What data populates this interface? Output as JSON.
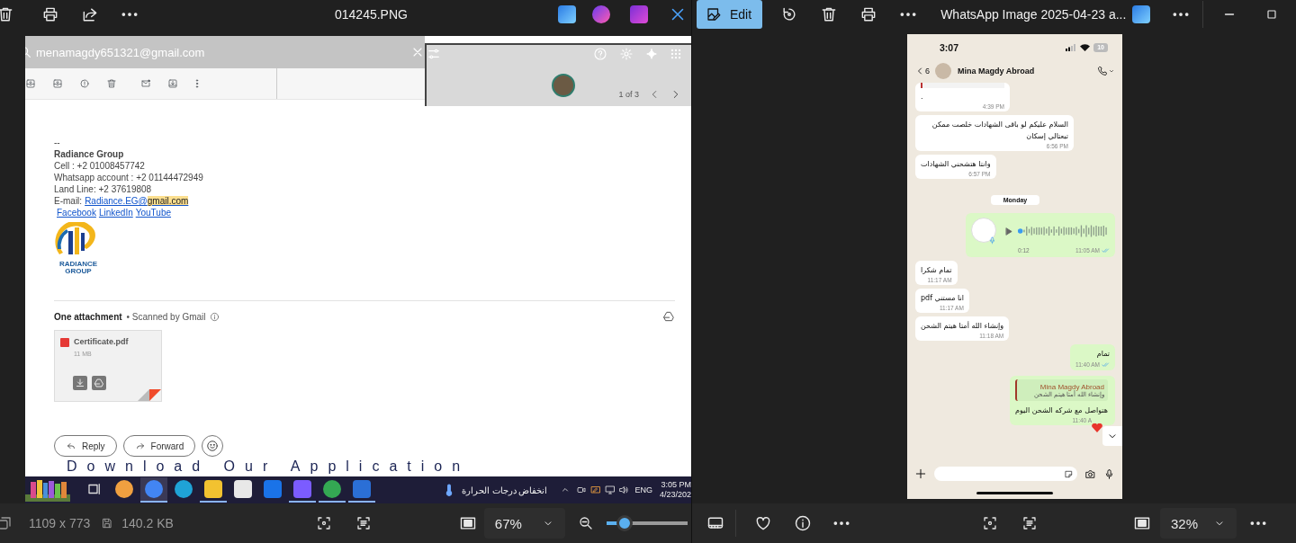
{
  "left_window": {
    "title": "014245.PNG",
    "info": {
      "dimensions": "1109 x 773",
      "file_size": "140.2 KB"
    },
    "zoom": {
      "value": "67%",
      "level": 0.22
    }
  },
  "email": {
    "search_value": "menamagdy651321@gmail.com",
    "pager": "1 of 3",
    "signature": {
      "separator": "--",
      "company": "Radiance Group",
      "lines": [
        "Cell : +2 01008457742",
        "Whatsapp account : +2 01144472949",
        "Land Line: +2 37619808"
      ],
      "email_label": "E-mail:",
      "email_link": "Radiance.EG@",
      "email_highlight": "gmail.com",
      "social_links": [
        "Facebook",
        "LinkedIn",
        "YouTube"
      ],
      "logo_text": [
        "RADIANCE",
        "GROUP"
      ]
    },
    "attachments": {
      "heading": "One attachment",
      "note": "• Scanned by Gmail",
      "files": [
        {
          "name": "Certificate.pdf",
          "size": "11 MB"
        }
      ]
    },
    "actions": [
      "Reply",
      "Forward"
    ],
    "banner": "Download Our Application"
  },
  "taskbar": {
    "apps": [
      {
        "running": false,
        "selected": false
      },
      {
        "running": false,
        "selected": false
      },
      {
        "running": true,
        "selected": true
      },
      {
        "running": false,
        "selected": false
      },
      {
        "running": true,
        "selected": false
      },
      {
        "running": false,
        "selected": false
      },
      {
        "running": false,
        "selected": false
      },
      {
        "running": true,
        "selected": false
      },
      {
        "running": true,
        "selected": false
      },
      {
        "running": true,
        "selected": false
      }
    ],
    "weather": "انخفاض درجات الحرارة",
    "language": "ENG",
    "time": "3:05 PM",
    "date": "4/23/202"
  },
  "right_window": {
    "edit_label": "Edit",
    "title": "WhatsApp Image 2025-04-23 a...",
    "zoom": {
      "value": "32%"
    }
  },
  "phone": {
    "time": "3:07",
    "battery": "10",
    "back_count": "6",
    "contact": "Mina Magdy Abroad",
    "messages": [
      {
        "kind": "clipped_reply",
        "outgoing": false,
        "text": ".",
        "time": "4:39 PM"
      },
      {
        "kind": "text",
        "outgoing": false,
        "text": "السلام عليكم لو باقى الشهادات خلصت ممكن تبعتالي إسكان",
        "time": "6:56 PM"
      },
      {
        "kind": "text",
        "outgoing": false,
        "text": "وانتا هتشحني الشهادات",
        "time": "6:57 PM"
      },
      {
        "kind": "date",
        "text": "Monday"
      },
      {
        "kind": "voice",
        "outgoing": true,
        "duration": "0:12",
        "time": "11:05 AM",
        "read": true
      },
      {
        "kind": "text",
        "outgoing": false,
        "text": "تمام شكرا",
        "time": "11:17 AM"
      },
      {
        "kind": "text",
        "outgoing": false,
        "text": "انا مستني pdf",
        "time": "11:17 AM"
      },
      {
        "kind": "text",
        "outgoing": false,
        "text": "وإنشاء الله أمتا هيتم الشحن",
        "time": "11:18 AM"
      },
      {
        "kind": "text",
        "outgoing": true,
        "text": "تمام",
        "time": "11:40 AM",
        "read": true
      },
      {
        "kind": "reply",
        "outgoing": true,
        "quote_author": "Mina Magdy Abroad",
        "quote_text": "وإنشاء الله أمتا هيتم الشحن",
        "text": "هتواصل مع شركه الشحن اليوم",
        "time": "11:40 A",
        "reaction": true
      }
    ]
  }
}
